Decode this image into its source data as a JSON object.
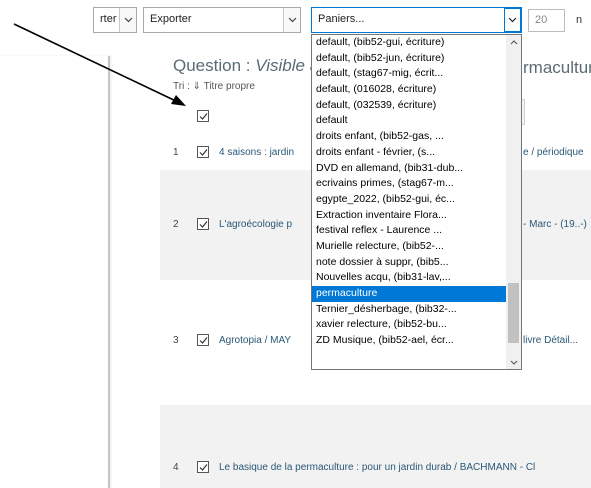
{
  "toolbar": {
    "partial_select": "rter",
    "export_select": "Exporter",
    "basket_select": "Paniers...",
    "per_page_value": "20",
    "per_page_suffix": "n"
  },
  "question": {
    "prefix": "Question : ",
    "italic": "Visible à",
    "right_fragment": "rmacultur"
  },
  "sort_label": "Tri : ⇓ Titre propre",
  "rows": [
    {
      "num": "1",
      "left": "4 saisons : jardin",
      "right": "e / périodique"
    },
    {
      "num": "2",
      "left": "L'agroécologie p",
      "right": "- Marc - (19..-)"
    },
    {
      "num": "3",
      "left": "Agrotopia / MAY",
      "right": "livre Détail..."
    },
    {
      "num": "4",
      "left": "Le basique de la permaculture : pour un jardin durab / BACHMANN - Cl",
      "right": ""
    }
  ],
  "dropdown": {
    "items": [
      "default, (bib52-gui, écriture)",
      "default, (bib52-jun, écriture)",
      "default, (stag67-mig, écrit...",
      "default, (016028, écriture)",
      "default, (032539, écriture)",
      "default",
      "droits enfant, (bib52-gas, ...",
      "droits enfant - février, (s...",
      "DVD en allemand, (bib31-dub...",
      "ecrivains primes, (stag67-m...",
      "egypte_2022, (bib52-gui, éc...",
      "Extraction inventaire Flora...",
      "festival reflex - Laurence ...",
      "Murielle relecture, (bib52-...",
      "note dossier à suppr, (bib5...",
      "Nouvelles acqu, (bib31-lav,...",
      "permaculture",
      "Ternier_désherbage, (bib32-...",
      "xavier relecture, (bib52-bu...",
      "ZD Musique, (bib52-ael, écr..."
    ],
    "selected_index": 16
  },
  "colors": {
    "selection": "#0078d7",
    "link_text": "#2a5877",
    "heading": "#5a6b74"
  }
}
